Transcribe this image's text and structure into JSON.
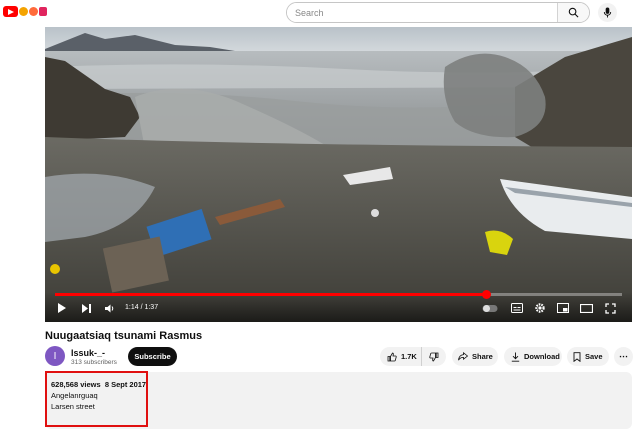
{
  "header": {
    "search_placeholder": "Search",
    "logo_icon": "youtube-doodle-logo",
    "search_icon": "search-icon",
    "mic_icon": "microphone-icon"
  },
  "player": {
    "time_current": "1:14",
    "time_total": "1:37",
    "time_display": "1:14 / 1:37",
    "progress_fraction": 0.76,
    "accent_color": "#ff0000"
  },
  "video": {
    "title": "Nuugaatsiaq tsunami Rasmus"
  },
  "channel": {
    "avatar_letter": "I",
    "name": "Issuk-_-",
    "subscribers": "313 subscribers",
    "subscribe_label": "Subscribe"
  },
  "actions": {
    "like_count": "1.7K",
    "share_label": "Share",
    "download_label": "Download",
    "save_label": "Save",
    "more_label": "⋯"
  },
  "description": {
    "views": "628,568 views",
    "date": "8 Sept 2017",
    "line1": "Angelanrguaq",
    "line2": "Larsen street"
  }
}
